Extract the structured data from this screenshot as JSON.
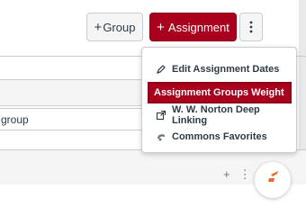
{
  "toolbar": {
    "group_button_label": "Group",
    "assignment_button_label": "Assignment"
  },
  "menu": {
    "items": [
      {
        "label": "Edit Assignment Dates",
        "icon": "pencil-icon"
      },
      {
        "label": "Assignment Groups Weight",
        "icon": ""
      },
      {
        "label": "W. W. Norton Deep Linking",
        "icon": "external-link-icon"
      },
      {
        "label": "Commons Favorites",
        "icon": "commons-icon"
      }
    ]
  },
  "list": {
    "row_partial_text": "group"
  },
  "colors": {
    "primary": "#a8001d",
    "text": "#2d3b45",
    "border": "#c7cdd1",
    "badge_orange": "#f26522"
  }
}
